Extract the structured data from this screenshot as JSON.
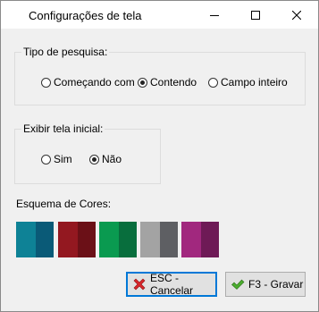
{
  "window": {
    "title": "Configurações de tela"
  },
  "search_type": {
    "legend": "Tipo de pesquisa:",
    "options": [
      {
        "label": "Começando com",
        "checked": false
      },
      {
        "label": "Contendo",
        "checked": true
      },
      {
        "label": "Campo inteiro",
        "checked": false
      }
    ]
  },
  "initial_screen": {
    "legend": "Exibir tela inicial:",
    "options": [
      {
        "label": "Sim",
        "checked": false
      },
      {
        "label": "Não",
        "checked": true
      }
    ]
  },
  "color_scheme": {
    "label": "Esquema de Cores:",
    "swatches": [
      {
        "name": "teal",
        "colors": [
          "#0e8296",
          "#0a5a77"
        ]
      },
      {
        "name": "red",
        "colors": [
          "#931820",
          "#6b1017"
        ]
      },
      {
        "name": "green",
        "colors": [
          "#0a9a50",
          "#086e3d"
        ]
      },
      {
        "name": "gray",
        "colors": [
          "#a3a3a3",
          "#5e5f63"
        ]
      },
      {
        "name": "magenta",
        "colors": [
          "#a1287e",
          "#6e1a56"
        ]
      }
    ]
  },
  "buttons": {
    "cancel_label": "ESC - Cancelar",
    "save_label": "F3 - Gravar"
  }
}
